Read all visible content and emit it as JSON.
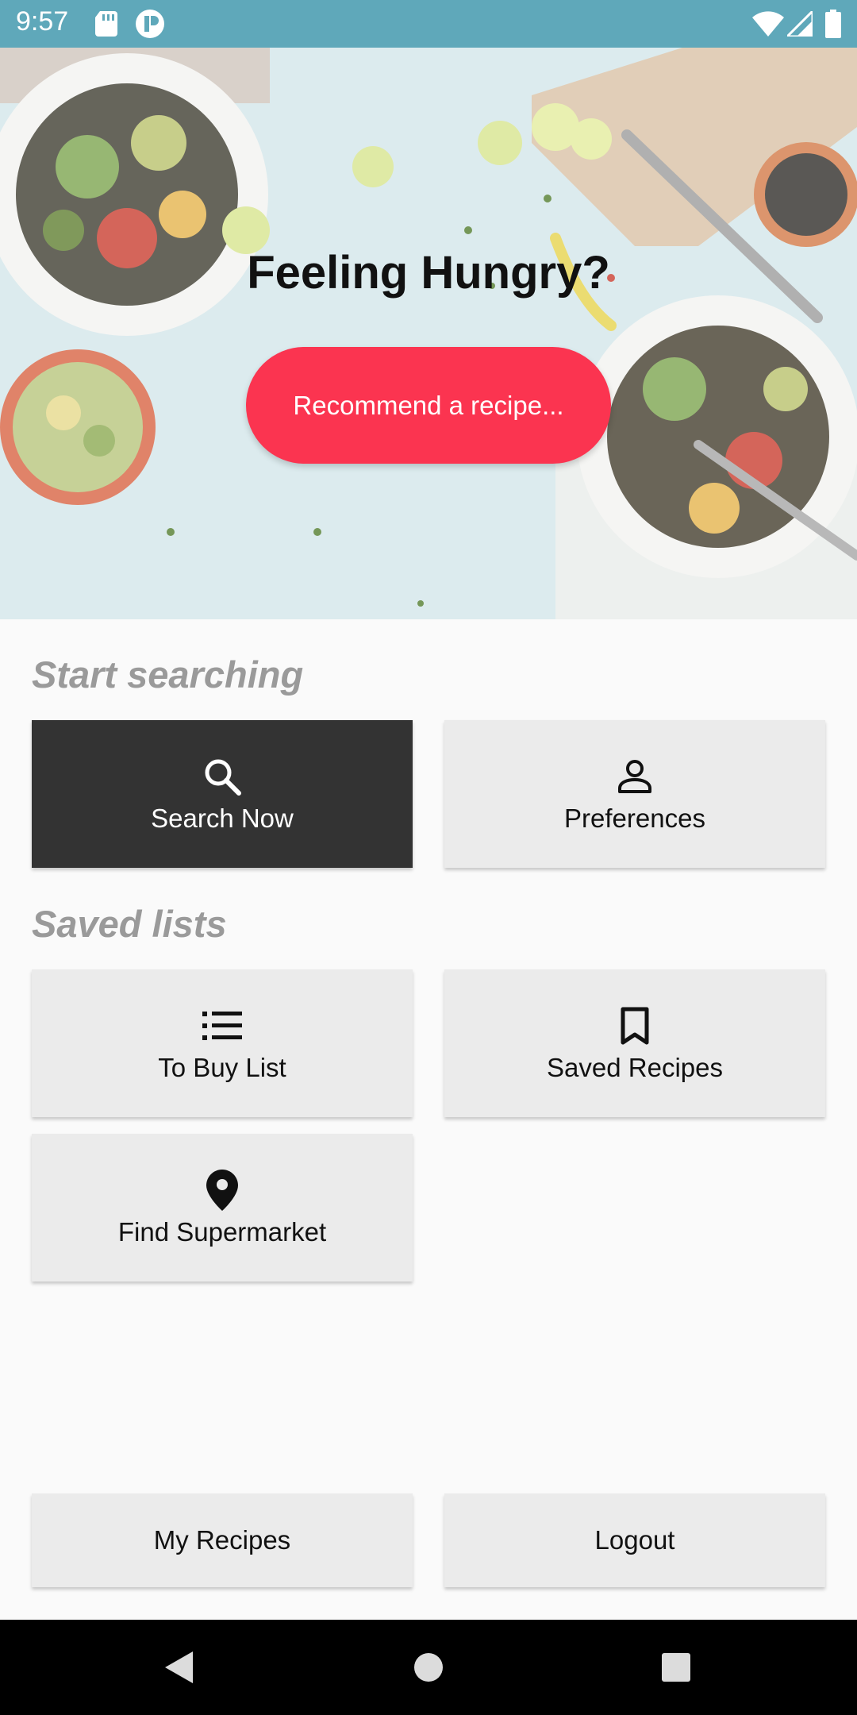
{
  "status_bar": {
    "time": "9:57",
    "icons_left": [
      "sd-card-icon",
      "notification-app-icon"
    ],
    "icons_right": [
      "wifi-icon",
      "cell-signal-icon",
      "battery-icon"
    ],
    "background": "#5fa8ba"
  },
  "hero": {
    "title": "Feeling Hungry?",
    "recommend_button": "Recommend a recipe...",
    "button_color": "#fb3450"
  },
  "start_searching": {
    "title": "Start searching",
    "search_button": "Search Now",
    "preferences_button": "Preferences"
  },
  "saved_lists": {
    "title": "Saved lists",
    "to_buy_button": "To Buy List",
    "saved_recipes_button": "Saved Recipes",
    "find_supermarket_button": "Find Supermarket"
  },
  "footer": {
    "my_recipes_button": "My Recipes",
    "logout_button": "Logout"
  },
  "nav_bar": {
    "icons": [
      "back-icon",
      "home-icon",
      "recents-icon"
    ]
  }
}
